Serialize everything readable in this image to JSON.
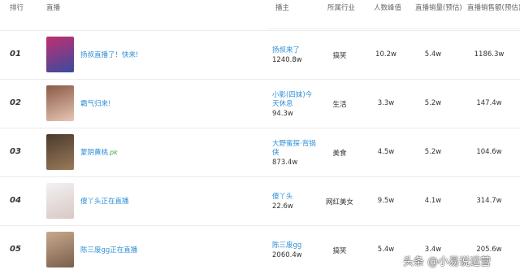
{
  "header": {
    "rank": "排行",
    "stream": "直播",
    "host": "播主",
    "industry": "所属行业",
    "peak": "人数峰值",
    "sales_count": "直播销量(预估)",
    "sales_amount": "直播销售额(预估)"
  },
  "rows": [
    {
      "rank": "01",
      "title": "扬叔直播了！快来!",
      "badge": "",
      "host": "扬叔来了",
      "fans": "1240.8w",
      "industry": "搞笑",
      "peak": "10.2w",
      "sales_count": "5.4w",
      "sales_amount": "1186.3w",
      "thumb_colors": [
        "#c0306f",
        "#3a4aa0"
      ]
    },
    {
      "rank": "02",
      "title": "霸气归来!",
      "badge": "",
      "host": "小影(四妹)今天休息",
      "fans": "94.3w",
      "industry": "生活",
      "peak": "3.3w",
      "sales_count": "5.2w",
      "sales_amount": "147.4w",
      "thumb_colors": [
        "#8a5a44",
        "#e8c6b6"
      ]
    },
    {
      "rank": "03",
      "title": "蒙阴黄桃",
      "badge": "pk",
      "host": "大野蜜探·背锅侠",
      "fans": "873.4w",
      "industry": "美食",
      "peak": "4.5w",
      "sales_count": "5.2w",
      "sales_amount": "104.6w",
      "thumb_colors": [
        "#4a3a2c",
        "#9a7a5a"
      ]
    },
    {
      "rank": "04",
      "title": "傻丫头正在直播",
      "badge": "",
      "host": "傻丫头",
      "fans": "22.6w",
      "industry": "网红美女",
      "peak": "9.5w",
      "sales_count": "4.1w",
      "sales_amount": "314.7w",
      "thumb_colors": [
        "#f2f2f2",
        "#d8c8c4"
      ]
    },
    {
      "rank": "05",
      "title": "陈三废gg正在直播",
      "badge": "",
      "host": "陈三废gg",
      "fans": "2060.4w",
      "industry": "搞笑",
      "peak": "5.4w",
      "sales_count": "3.4w",
      "sales_amount": "205.6w",
      "thumb_colors": [
        "#c9a98c",
        "#7a5e4c"
      ]
    }
  ],
  "watermark": "头条 @小易说运营"
}
